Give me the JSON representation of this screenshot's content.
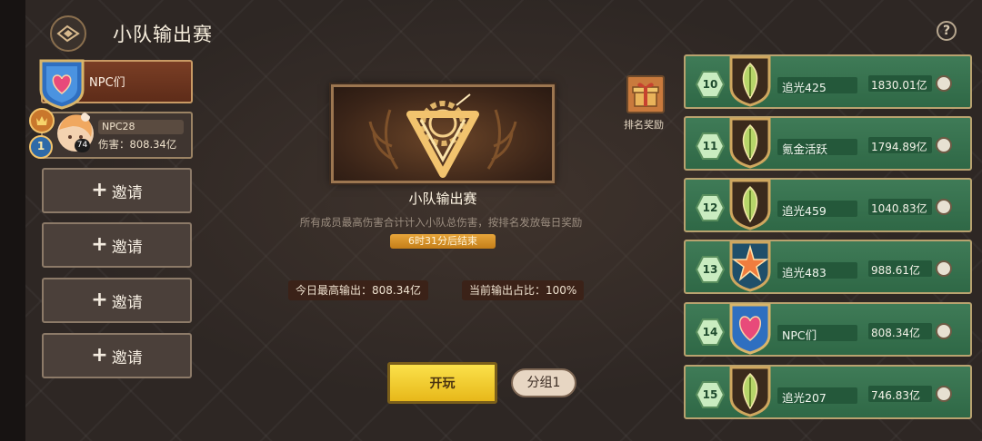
{
  "header": {
    "title": "小队输出赛",
    "help": "?"
  },
  "team": {
    "name": "NPC们",
    "member": {
      "name": "NPC28",
      "damage": "伤害：808.34亿",
      "level": "74",
      "rank_badge": "1"
    },
    "invite_slots": [
      {
        "label": "邀请"
      },
      {
        "label": "邀请"
      },
      {
        "label": "邀请"
      },
      {
        "label": "邀请"
      }
    ]
  },
  "event": {
    "title": "小队输出赛",
    "description": "所有成员最高伤害合计计入小队总伤害，按排名发放每日奖励",
    "timer": "6时31分后结束",
    "today_best": "今日最高输出：808.34亿",
    "share": "当前输出占比：100%",
    "play_label": "开玩",
    "group_label": "分组1"
  },
  "reward": {
    "label": "排名奖励"
  },
  "ranking": [
    {
      "rank": "10",
      "name": "追光425",
      "value": "1830.01亿",
      "emblem": "leaf-emblem"
    },
    {
      "rank": "11",
      "name": "氪金活跃",
      "value": "1794.89亿",
      "emblem": "leaf-emblem"
    },
    {
      "rank": "12",
      "name": "追光459",
      "value": "1040.83亿",
      "emblem": "leaf-emblem"
    },
    {
      "rank": "13",
      "name": "追光483",
      "value": "988.61亿",
      "emblem": "star-emblem"
    },
    {
      "rank": "14",
      "name": "NPC们",
      "value": "808.34亿",
      "emblem": "heart-emblem"
    },
    {
      "rank": "15",
      "name": "追光207",
      "value": "746.83亿",
      "emblem": "leaf-emblem"
    }
  ],
  "colors": {
    "accent": "#f2c62e",
    "row_green": "#3f7b57",
    "team_red": "#7a3e25"
  }
}
